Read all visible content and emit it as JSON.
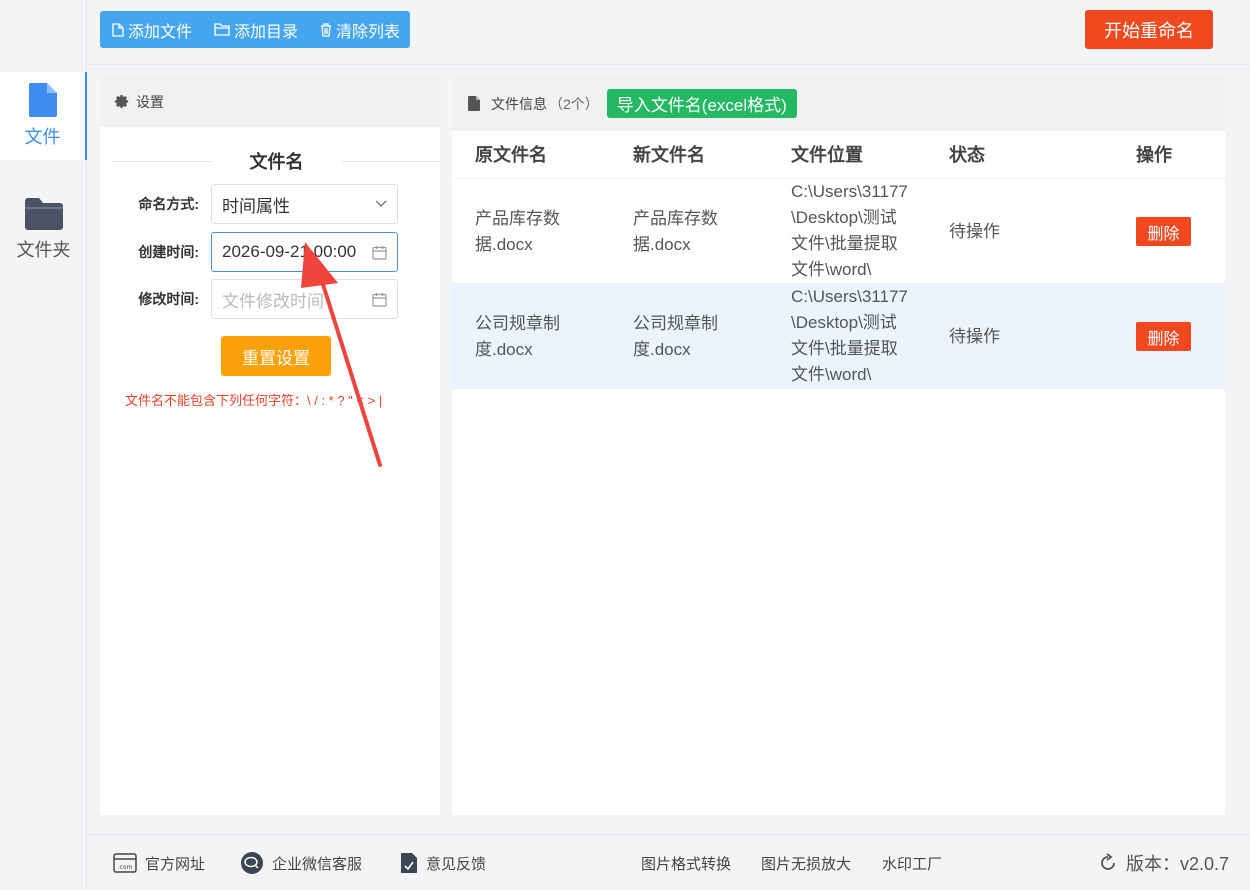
{
  "rail": {
    "items": [
      {
        "label": "文件",
        "icon": "file-icon"
      },
      {
        "label": "文件夹",
        "icon": "folder-icon"
      }
    ]
  },
  "toolbar": {
    "add_file": "添加文件",
    "add_dir": "添加目录",
    "clear_list": "清除列表",
    "start": "开始重命名"
  },
  "settings": {
    "header": "设置",
    "section_title": "文件名",
    "naming_mode_label": "命名方式:",
    "naming_mode_value": "时间属性",
    "create_time_label": "创建时间:",
    "create_time_value": "2026-09-21 00:00",
    "modify_time_label": "修改时间:",
    "modify_time_placeholder": "文件修改时间",
    "reset": "重置设置",
    "warning": "文件名不能包含下列任何字符：\\ / : * ? \" < > |"
  },
  "files": {
    "header": "文件信息",
    "count": "（2个）",
    "import": "导入文件名(excel格式)",
    "columns": [
      "原文件名",
      "新文件名",
      "文件位置",
      "状态",
      "操作"
    ],
    "rows": [
      {
        "orig": "产品库存数据.docx",
        "new": "产品库存数据.docx",
        "path": "C:\\Users\\31177\\Desktop\\测试文件\\批量提取文件\\word\\",
        "status": "待操作",
        "action": "删除"
      },
      {
        "orig": "公司规章制度.docx",
        "new": "公司规章制度.docx",
        "path": "C:\\Users\\31177\\Desktop\\测试文件\\批量提取文件\\word\\",
        "status": "待操作",
        "action": "删除"
      }
    ]
  },
  "footer": {
    "website": "官方网址",
    "wechat": "企业微信客服",
    "feedback": "意见反馈",
    "img_convert": "图片格式转换",
    "img_upscale": "图片无损放大",
    "watermark": "水印工厂",
    "version": "版本：v2.0.7"
  },
  "colors": {
    "accent": "#45a5ee",
    "danger": "#f0491f",
    "success": "#23b862",
    "warning": "#fca10a"
  }
}
